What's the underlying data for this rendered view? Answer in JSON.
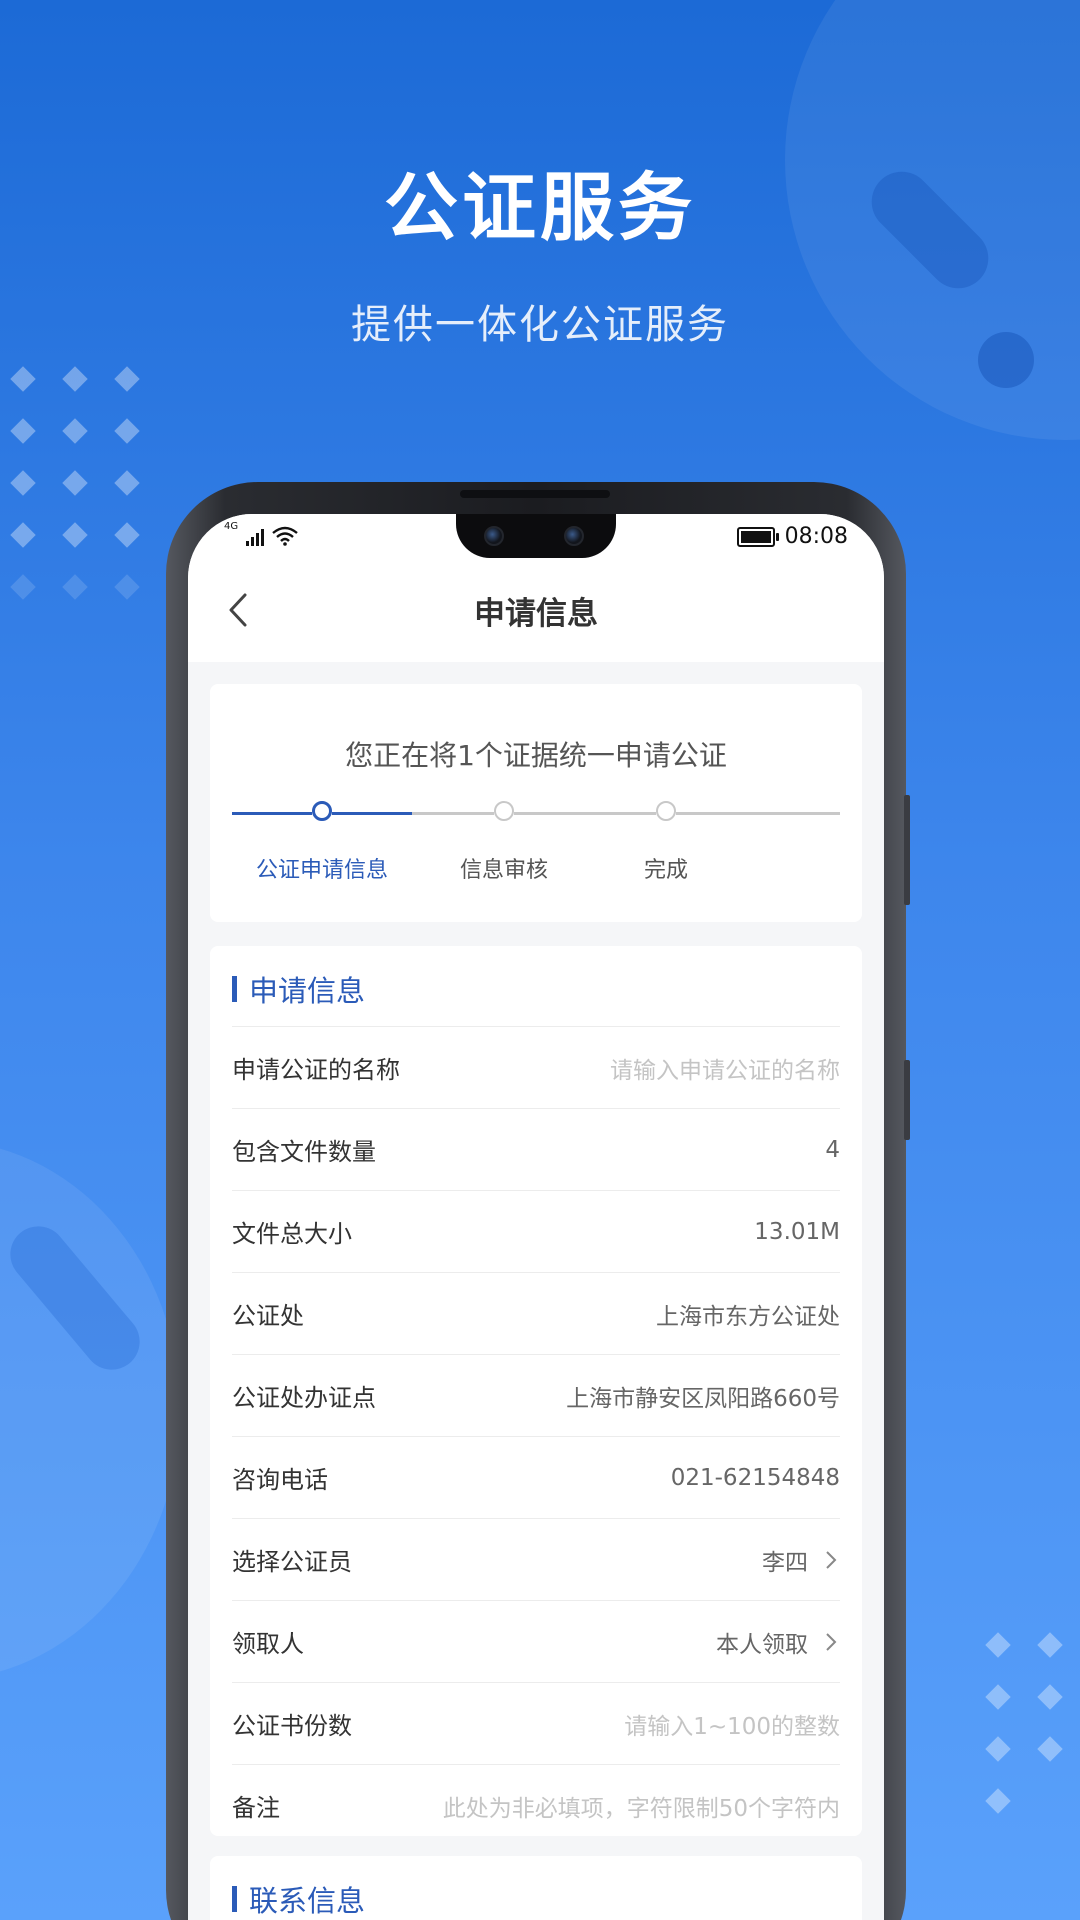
{
  "hero": {
    "title": "公证服务",
    "subtitle": "提供一体化公证服务"
  },
  "status_bar": {
    "network": "4G",
    "time": "08:08",
    "icons": [
      "signal-icon",
      "wifi-icon",
      "battery-icon"
    ]
  },
  "nav": {
    "back_icon": "chevron-left-icon",
    "title": "申请信息"
  },
  "progress": {
    "note": "您正在将1个证据统一申请公证",
    "steps": [
      {
        "label": "公证申请信息",
        "active": true
      },
      {
        "label": "信息审核",
        "active": false
      },
      {
        "label": "完成",
        "active": false
      }
    ]
  },
  "application_section": {
    "title": "申请信息",
    "rows": [
      {
        "label": "申请公证的名称",
        "value": "请输入申请公证的名称",
        "placeholder": true
      },
      {
        "label": "包含文件数量",
        "value": "4"
      },
      {
        "label": "文件总大小",
        "value": "13.01M"
      },
      {
        "label": "公证处",
        "value": "上海市东方公证处"
      },
      {
        "label": "公证处办证点",
        "value": "上海市静安区凤阳路660号"
      },
      {
        "label": "咨询电话",
        "value": "021-62154848"
      },
      {
        "label": "选择公证员",
        "value": "李四",
        "chevron": true
      },
      {
        "label": "领取人",
        "value": "本人领取",
        "chevron": true
      },
      {
        "label": "公证书份数",
        "value": "请输入1~100的整数",
        "placeholder": true
      },
      {
        "label": "备注",
        "value": "此处为非必填项，字符限制50个字符内",
        "placeholder": true
      }
    ]
  },
  "contact_section": {
    "title": "联系信息"
  },
  "colors": {
    "accent": "#2b5bb8",
    "background_top": "#1c6ad6",
    "background_bottom": "#5aa1fb",
    "placeholder": "#c4c4c4",
    "inactive_step": "#c8c8c8"
  }
}
